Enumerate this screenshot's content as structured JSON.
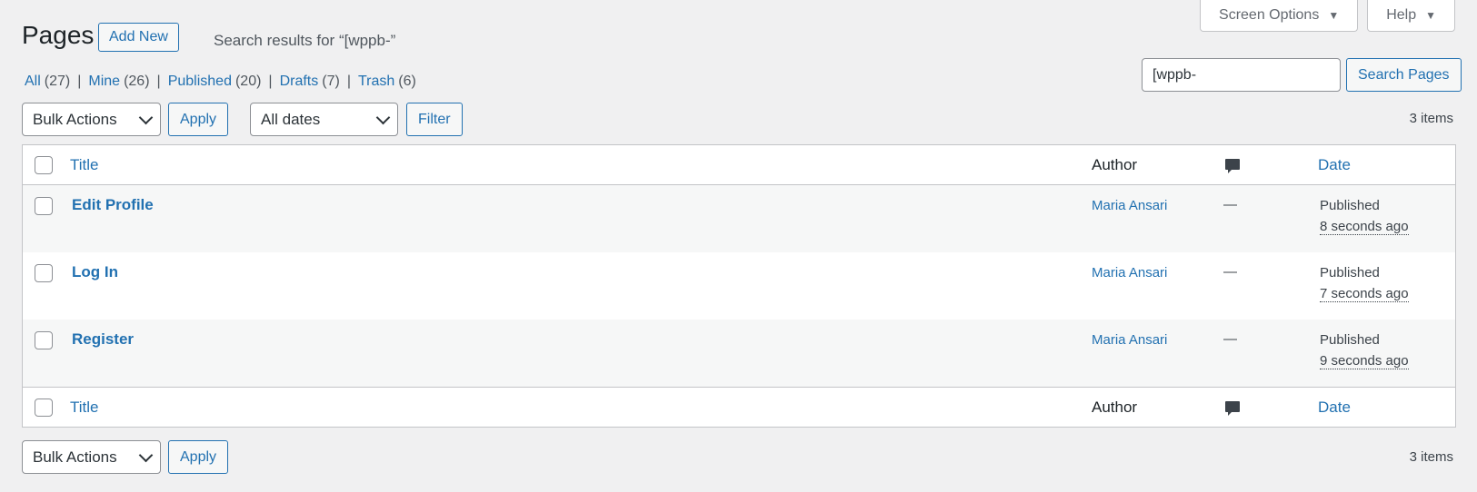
{
  "screen_meta": {
    "screen_options_label": "Screen Options",
    "help_label": "Help"
  },
  "heading": {
    "title": "Pages",
    "add_new_label": "Add New",
    "subtitle": "Search results for “[wppb-”"
  },
  "views": [
    {
      "label": "All",
      "count": "(27)"
    },
    {
      "label": "Mine",
      "count": "(26)"
    },
    {
      "label": "Published",
      "count": "(20)"
    },
    {
      "label": "Drafts",
      "count": "(7)"
    },
    {
      "label": "Trash",
      "count": "(6)"
    }
  ],
  "search": {
    "value": "[wppb-",
    "button_label": "Search Pages"
  },
  "tablenav_top": {
    "bulk_actions": "Bulk Actions",
    "apply_label": "Apply",
    "dates": "All dates",
    "filter_label": "Filter",
    "items": "3 items"
  },
  "table": {
    "columns": {
      "title": "Title",
      "author": "Author",
      "date": "Date"
    },
    "rows": [
      {
        "title": "Edit Profile",
        "author": "Maria Ansari",
        "comments": "—",
        "status": "Published",
        "ago": "8 seconds ago"
      },
      {
        "title": "Log In",
        "author": "Maria Ansari",
        "comments": "—",
        "status": "Published",
        "ago": "7 seconds ago"
      },
      {
        "title": "Register",
        "author": "Maria Ansari",
        "comments": "—",
        "status": "Published",
        "ago": "9 seconds ago"
      }
    ]
  },
  "tablenav_bottom": {
    "bulk_actions": "Bulk Actions",
    "apply_label": "Apply",
    "items": "3 items"
  },
  "colors": {
    "link": "#2271b1",
    "background": "#f0f0f1",
    "alt_row": "#f6f7f7"
  },
  "icons": {
    "comments": "comment-bubble-icon",
    "dropdown": "chevron-down-icon",
    "toggle": "triangle-down-icon"
  }
}
